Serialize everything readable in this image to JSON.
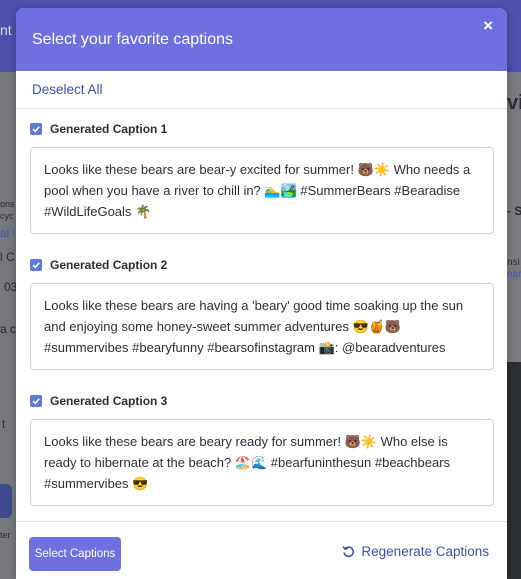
{
  "modal": {
    "title": "Select your favorite captions",
    "close_glyph": "×",
    "deselect_label": "Deselect All"
  },
  "captions": [
    {
      "label": "Generated Caption 1",
      "checked": true,
      "text": "Looks like these bears are bear-y excited for summer! 🐻☀️ Who needs a pool when you have a river to chill in? 🏊‍♂️🏞️ #SummerBears #Bearadise #WildLifeGoals 🌴"
    },
    {
      "label": "Generated Caption 2",
      "checked": true,
      "text": "Looks like these bears are having a 'beary' good time soaking up the sun and enjoying some honey-sweet summer adventures 😎🍯🐻 #summervibes #bearyfunny #bearsofinstagram 📸: @bearadventures"
    },
    {
      "label": "Generated Caption 3",
      "checked": true,
      "text": "Looks like these bears are beary ready for summer! 🐻☀️ Who else is ready to hibernate at the beach? 🏖️🌊 #bearfuninthesun #beachbears #summervibes 😎"
    }
  ],
  "footer": {
    "select_label": "Select Captions",
    "regenerate_label": "Regenerate Captions"
  },
  "background": {
    "header_fragment": "nt",
    "right_big_fragment": "vi",
    "left_fragments": [
      "ons",
      "cyc",
      "al ⓘ",
      "l C",
      "03",
      "a c",
      "t",
      "ter"
    ],
    "right_fragments": [
      "- S",
      "nsi",
      "nar"
    ]
  },
  "colors": {
    "accent": "#6e70e0",
    "link": "#3651b0",
    "checkbox": "#5a7bd6"
  }
}
